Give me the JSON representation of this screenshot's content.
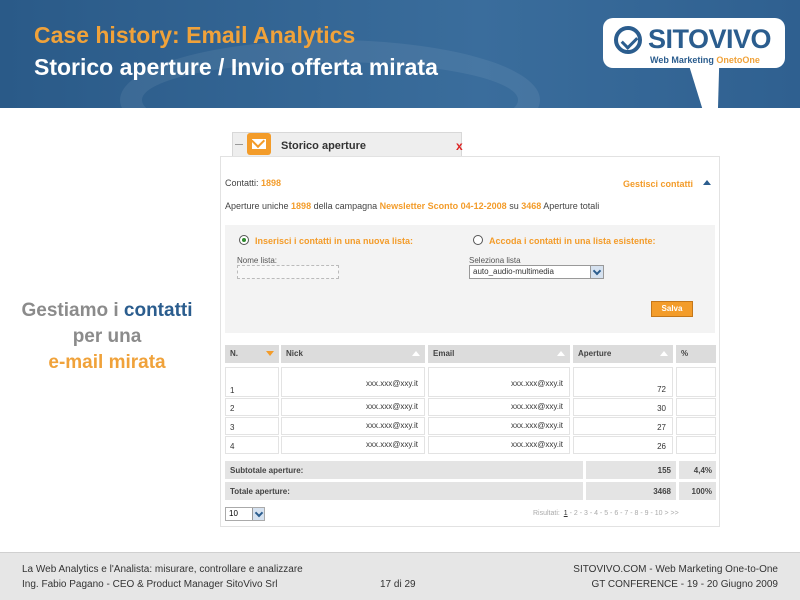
{
  "header": {
    "title": "Case history: Email Analytics",
    "subtitle": "Storico aperture / Invio offerta mirata"
  },
  "logo": {
    "name": "SITOVIVO",
    "tagline_a": "Web Marketing ",
    "tagline_b": "OnetoOne"
  },
  "caption": {
    "l1a": "Gestiamo i ",
    "l1b": "contatti",
    "l2": "per una",
    "l3": "e-mail mirata"
  },
  "widget": {
    "tab_title": "Storico aperture",
    "close": "x",
    "contatti_label": "Contatti: ",
    "contatti_value": "1898",
    "gestisci": "Gestisci contatti",
    "aperture_pre": "Aperture uniche ",
    "aperture_value": "1898",
    "aperture_mid": " della campagna ",
    "campaign": "Newsletter Sconto 04-12-2008",
    "aperture_su": " su ",
    "totali_value": "3468",
    "aperture_post": " Aperture totali",
    "radio_new": "Inserisci i contatti in una nuova lista:",
    "radio_existing": "Accoda i contatti in una lista esistente:",
    "nome_lista_label": "Nome lista:",
    "nome_lista_value": "",
    "seleziona_label": "Seleziona lista",
    "seleziona_value": "auto_audio-multimedia",
    "salva": "Salva",
    "columns": [
      "N.",
      "Nick",
      "Email",
      "Aperture",
      "%"
    ],
    "rows": [
      {
        "n": "1",
        "nick": "xxx.xxx@xxy.it",
        "email": "xxx.xxx@xxy.it",
        "aperture": "72",
        "pct": ""
      },
      {
        "n": "2",
        "nick": "xxx.xxx@xxy.it",
        "email": "xxx.xxx@xxy.it",
        "aperture": "30",
        "pct": ""
      },
      {
        "n": "3",
        "nick": "xxx.xxx@xxy.it",
        "email": "xxx.xxx@xxy.it",
        "aperture": "27",
        "pct": ""
      },
      {
        "n": "4",
        "nick": "xxx.xxx@xxy.it",
        "email": "xxx.xxx@xxy.it",
        "aperture": "26",
        "pct": ""
      }
    ],
    "subtotal_label": "Subtotale aperture:",
    "subtotal_value": "155",
    "subtotal_pct": "4,4%",
    "total_label": "Totale aperture:",
    "total_value": "3468",
    "total_pct": "100%",
    "page_size": "10",
    "pager_label": "Risultati:",
    "pager_current": "1",
    "pager_rest": " - 2 - 3 - 4 - 5 - 6 - 7 - 8 - 9 - 10  >  >>"
  },
  "footer": {
    "left1": "La Web Analytics e l'Analista: misurare, controllare e analizzare",
    "left2": "Ing. Fabio Pagano - CEO & Product Manager SitoVivo Srl",
    "page": "17 di 29",
    "right1": "SITOVIVO.COM - Web Marketing One-to-One",
    "right2": "GT CONFERENCE - 19 - 20 Giugno 2009"
  }
}
